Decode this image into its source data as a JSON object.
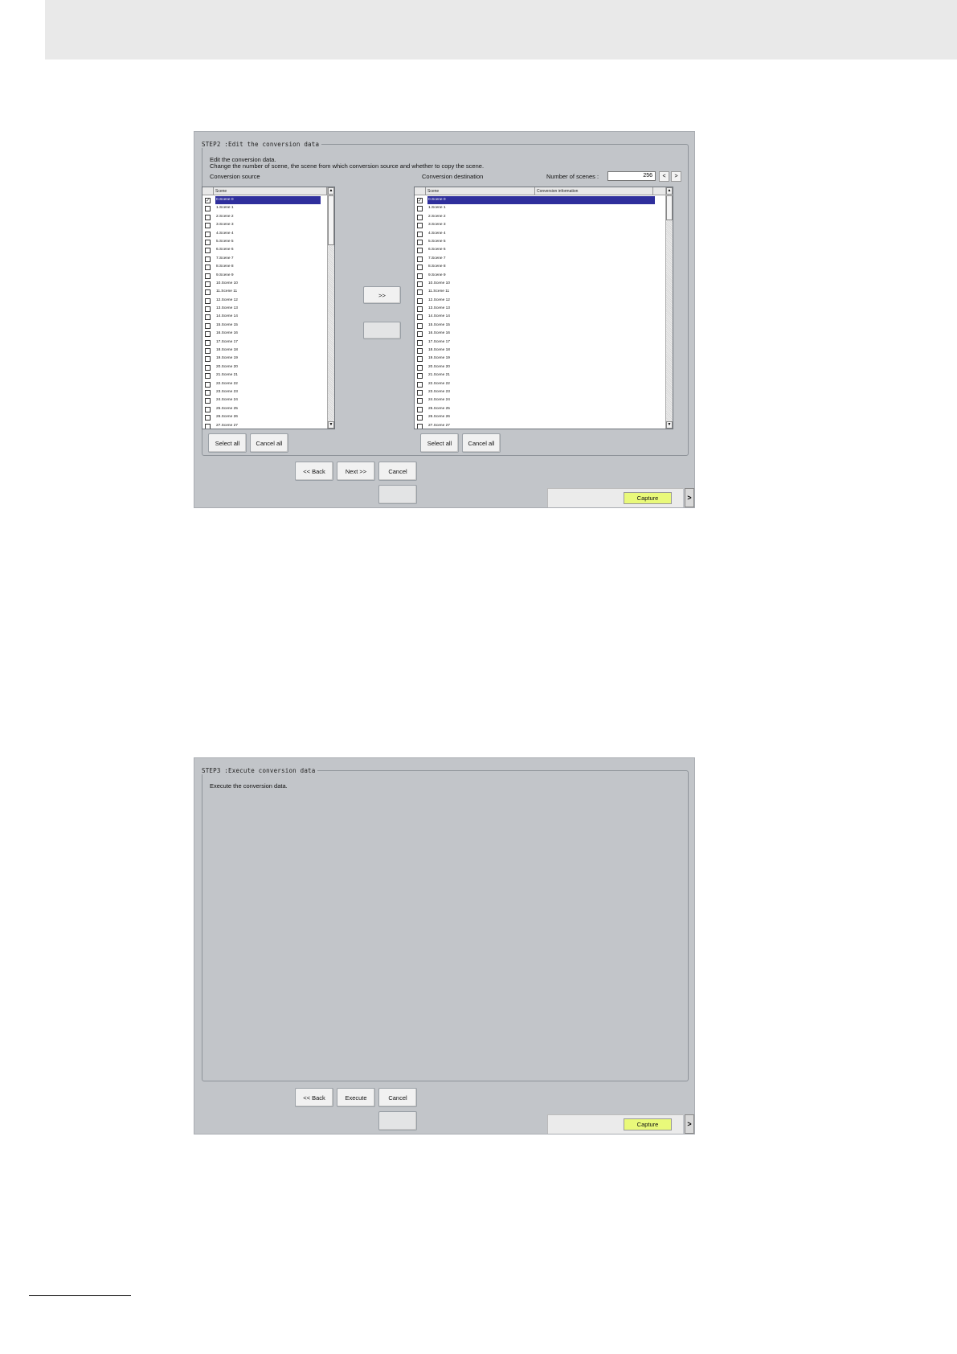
{
  "step2": {
    "legend": "STEP2 :Edit the conversion data",
    "intro_line1": "Edit the conversion data.",
    "intro_line2": "Change the number of scene, the scene from which conversion source and whether to copy the scene.",
    "source_label": "Conversion source",
    "destination_label": "Conversion destination",
    "num_scenes_label": "Number of scenes :",
    "num_scenes_value": "256",
    "prev_arrow": "<",
    "next_arrow": ">",
    "source_columns": [
      "Scene"
    ],
    "destination_columns": [
      "Scene",
      "Conversion information"
    ],
    "scenes": [
      "0.Scene 0",
      "1.Scene 1",
      "2.Scene 2",
      "3.Scene 3",
      "4.Scene 4",
      "5.Scene 5",
      "6.Scene 6",
      "7.Scene 7",
      "8.Scene 8",
      "9.Scene 9",
      "10.Scene 10",
      "11.Scene 11",
      "12.Scene 12",
      "13.Scene 13",
      "14.Scene 14",
      "15.Scene 15",
      "16.Scene 16",
      "17.Scene 17",
      "18.Scene 18",
      "19.Scene 19",
      "20.Scene 20",
      "21.Scene 21",
      "22.Scene 22",
      "23.Scene 23",
      "24.Scene 24",
      "25.Scene 25",
      "26.Scene 26",
      "27.Scene 27"
    ],
    "selected_index": 0,
    "copy_button": ">>",
    "select_all": "Select all",
    "cancel_all": "Cancel all",
    "back": "<< Back",
    "next": "Next >>",
    "cancel": "Cancel",
    "capture": "Capture",
    "expander": ">"
  },
  "step3": {
    "legend": "STEP3 :Execute conversion data",
    "intro": "Execute the conversion data.",
    "back": "<< Back",
    "execute": "Execute",
    "cancel": "Cancel",
    "capture": "Capture",
    "expander": ">"
  }
}
